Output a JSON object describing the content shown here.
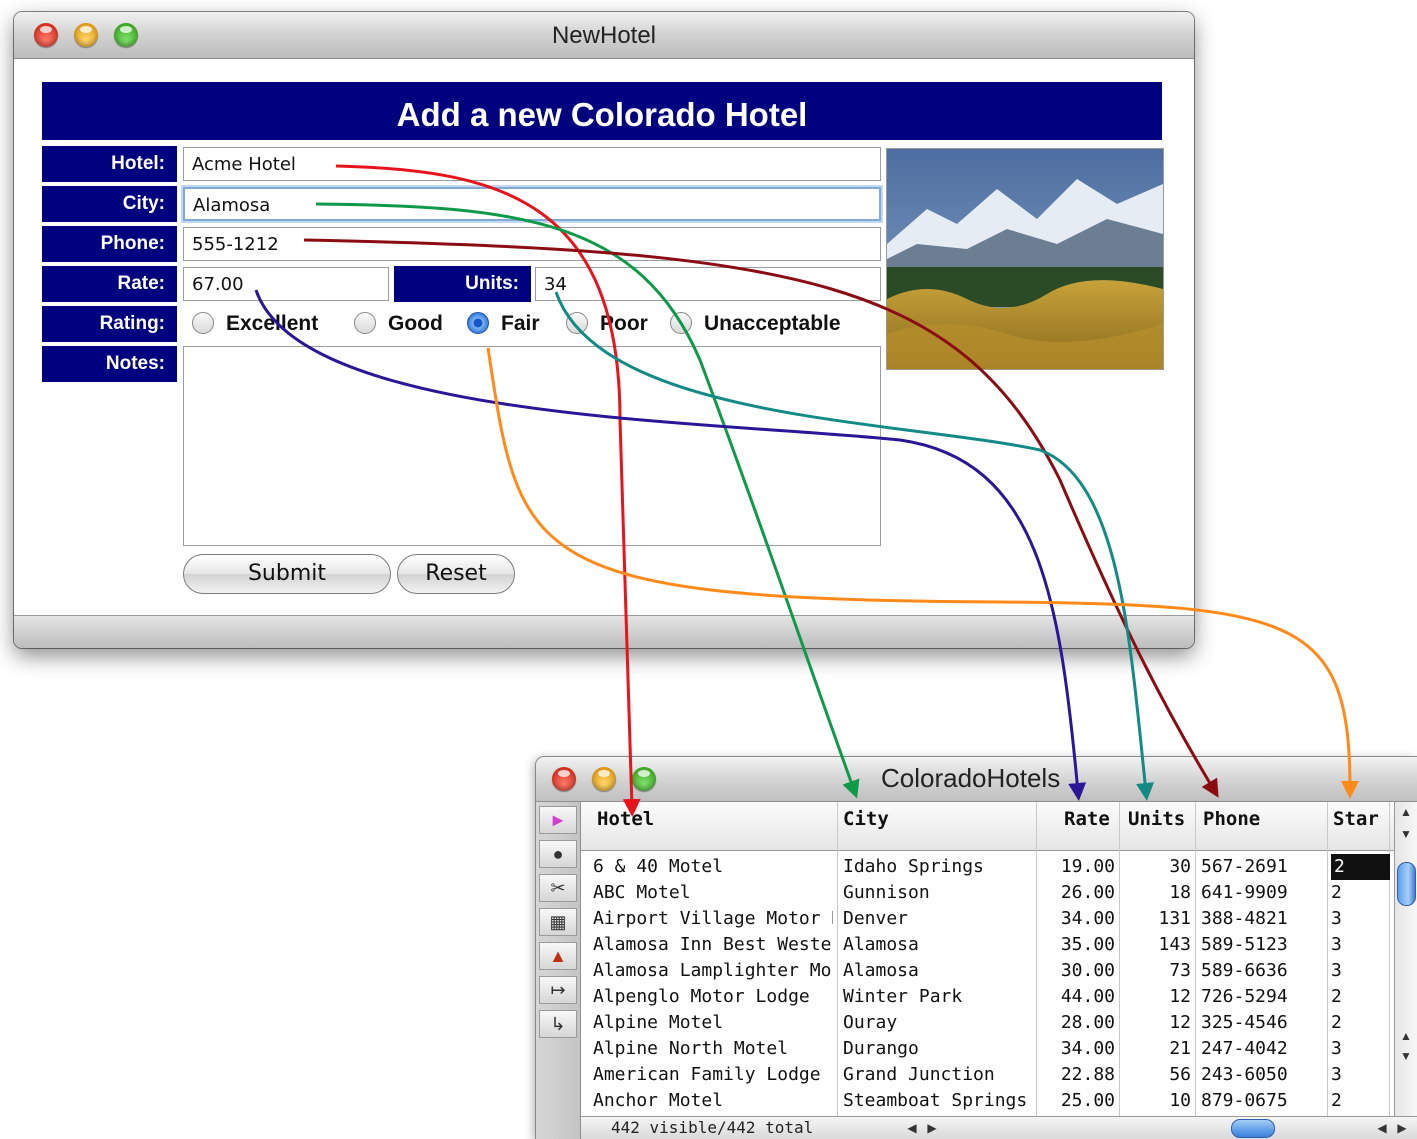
{
  "form_window": {
    "title": "NewHotel",
    "banner": "Add a new Colorado Hotel",
    "labels": {
      "hotel": "Hotel:",
      "city": "City:",
      "phone": "Phone:",
      "rate": "Rate:",
      "units": "Units:",
      "rating": "Rating:",
      "notes": "Notes:"
    },
    "values": {
      "hotel": "Acme Hotel",
      "city": "Alamosa",
      "phone": "555-1212",
      "rate": "67.00",
      "units": "34",
      "notes": ""
    },
    "rating_options": [
      "Excellent",
      "Good",
      "Fair",
      "Poor",
      "Unacceptable"
    ],
    "rating_selected": "Fair",
    "buttons": {
      "submit": "Submit",
      "reset": "Reset"
    }
  },
  "table_window": {
    "title": "ColoradoHotels",
    "columns": [
      "Hotel",
      "City",
      "Rate",
      "Units",
      "Phone",
      "Star"
    ],
    "rows": [
      [
        "6 & 40 Motel",
        "Idaho Springs",
        "19.00",
        "30",
        "567-2691",
        "2"
      ],
      [
        "ABC Motel",
        "Gunnison",
        "26.00",
        "18",
        "641-9909",
        "2"
      ],
      [
        "Airport Village Motor Hc",
        "Denver",
        "34.00",
        "131",
        "388-4821",
        "3"
      ],
      [
        "Alamosa Inn Best Wester",
        "Alamosa",
        "35.00",
        "143",
        "589-5123",
        "3"
      ],
      [
        "Alamosa Lamplighter Mo",
        "Alamosa",
        "30.00",
        "73",
        "589-6636",
        "3"
      ],
      [
        "Alpenglo Motor Lodge",
        "Winter Park",
        "44.00",
        "12",
        "726-5294",
        "2"
      ],
      [
        "Alpine Motel",
        "Ouray",
        "28.00",
        "12",
        "325-4546",
        "2"
      ],
      [
        "Alpine North Motel",
        "Durango",
        "34.00",
        "21",
        "247-4042",
        "3"
      ],
      [
        "American Family Lodge",
        "Grand Junction",
        "22.88",
        "56",
        "243-6050",
        "3"
      ],
      [
        "Anchor Motel",
        "Steamboat Springs",
        "25.00",
        "10",
        "879-0675",
        "2"
      ]
    ],
    "status": "442 visible/442 total"
  },
  "connector_colors": {
    "hotel": "#e8141c",
    "city": "#0f9a4a",
    "phone": "#8a0d14",
    "rate": "#2a1696",
    "units": "#138a86",
    "rating": "#ff8a1a"
  }
}
